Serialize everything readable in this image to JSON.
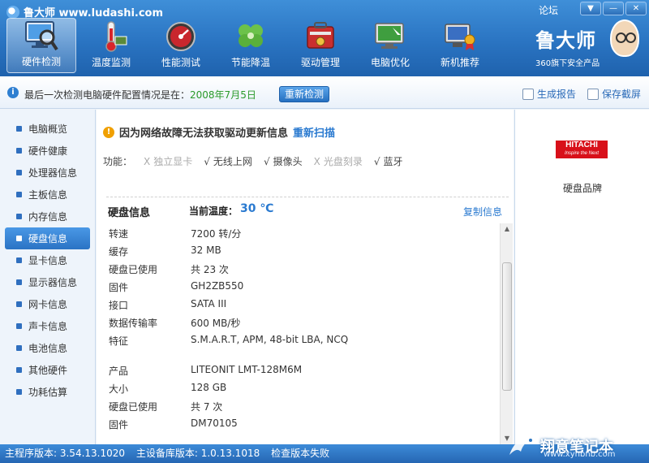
{
  "app": {
    "title": "鲁大师 www.ludashi.com",
    "forum": "论坛"
  },
  "nav": [
    {
      "label": "硬件检测",
      "icon": "monitor-magnifier-icon",
      "active": true
    },
    {
      "label": "温度监测",
      "icon": "thermometer-icon"
    },
    {
      "label": "性能测试",
      "icon": "speedometer-icon"
    },
    {
      "label": "节能降温",
      "icon": "clover-icon"
    },
    {
      "label": "驱动管理",
      "icon": "toolbox-icon"
    },
    {
      "label": "电脑优化",
      "icon": "optimize-monitor-icon"
    },
    {
      "label": "新机推荐",
      "icon": "computer-award-icon"
    }
  ],
  "brand": {
    "name": "鲁大师",
    "sub": "360旗下安全产品"
  },
  "infobar": {
    "text": "最后一次检测电脑硬件配置情况是在：",
    "date": "2008年7月5日",
    "recheck": "重新检测",
    "report": "生成报告",
    "screenshot": "保存截屏"
  },
  "sidebar": {
    "items": [
      {
        "label": "电脑概览"
      },
      {
        "label": "硬件健康"
      },
      {
        "label": "处理器信息"
      },
      {
        "label": "主板信息"
      },
      {
        "label": "内存信息"
      },
      {
        "label": "硬盘信息",
        "active": true
      },
      {
        "label": "显卡信息"
      },
      {
        "label": "显示器信息"
      },
      {
        "label": "网卡信息"
      },
      {
        "label": "声卡信息"
      },
      {
        "label": "电池信息"
      },
      {
        "label": "其他硬件"
      },
      {
        "label": "功耗估算"
      }
    ]
  },
  "main": {
    "warning": "因为网络故障无法获取驱动更新信息",
    "rescan": "重新扫描",
    "features_label": "功能：",
    "features": [
      {
        "mark": "X",
        "label": "独立显卡",
        "on": false
      },
      {
        "mark": "√",
        "label": "无线上网",
        "on": true
      },
      {
        "mark": "√",
        "label": "摄像头",
        "on": true
      },
      {
        "mark": "X",
        "label": "光盘刻录",
        "on": false
      },
      {
        "mark": "√",
        "label": "蓝牙",
        "on": true
      }
    ],
    "disk_title": "硬盘信息",
    "temp_label": "当前温度：",
    "temp_value": "30 ℃",
    "copy": "复制信息",
    "specs": [
      {
        "key": "转速",
        "value": "7200 转/分"
      },
      {
        "key": "缓存",
        "value": "32 MB"
      },
      {
        "key": "硬盘已使用",
        "value": "共 23 次"
      },
      {
        "key": "固件",
        "value": "GH2ZB550"
      },
      {
        "key": "接口",
        "value": "SATA III"
      },
      {
        "key": "数据传输率",
        "value": "600 MB/秒"
      },
      {
        "key": "特征",
        "value": "S.M.A.R.T,  APM,  48-bit LBA,  NCQ"
      },
      {
        "key": "产品",
        "value": "LITEONIT LMT-128M6M"
      },
      {
        "key": "大小",
        "value": "128 GB"
      },
      {
        "key": "硬盘已使用",
        "value": "共 7 次"
      },
      {
        "key": "固件",
        "value": "DM70105"
      }
    ]
  },
  "right": {
    "logo_line1": "HITACHI",
    "logo_line2": "Inspire the Next",
    "label": "硬盘品牌"
  },
  "footer": {
    "main_version": "主程序版本: 3.54.13.1020",
    "db_version": "主设备库版本: 1.0.13.1018",
    "check": "检查版本失败"
  },
  "watermark": {
    "text": "翔意笔记本",
    "url": "www.xynbnb.com"
  },
  "colors": {
    "header": "#2a74c2",
    "accent": "#2a7ad0",
    "date": "#2a9a2a",
    "warning": "#f0a000",
    "hitachi": "#d8101a"
  }
}
